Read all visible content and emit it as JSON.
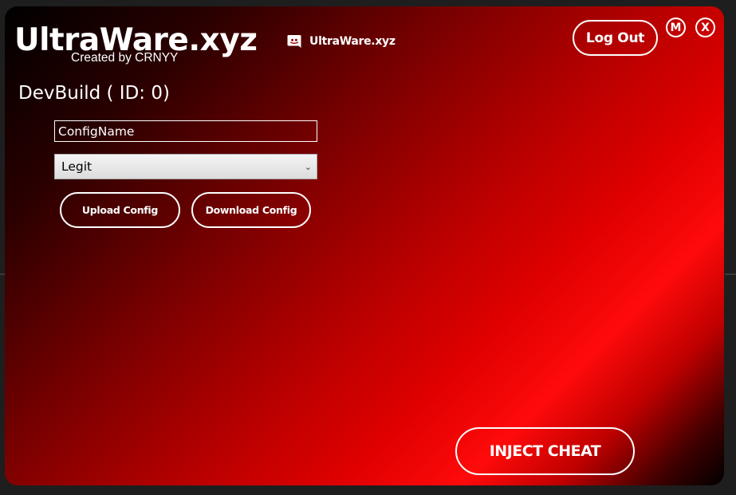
{
  "app": {
    "title": "UltraWare.xyz",
    "created_by": "Created by CRNYY",
    "build_label": "DevBuild ( ID: 0)"
  },
  "header": {
    "discord_icon": "discord-icon",
    "discord_label": "UltraWare.xyz",
    "logout_label": "Log Out",
    "minimize_label": "M",
    "close_label": "X"
  },
  "config": {
    "name_value": "ConfigName",
    "preset_selected": "Legit",
    "upload_label": "Upload Config",
    "download_label": "Download Config"
  },
  "footer": {
    "inject_label": "INJECT CHEAT"
  },
  "colors": {
    "accent": "#ff0a0a",
    "dark": "#000000",
    "text": "#ffffff"
  }
}
